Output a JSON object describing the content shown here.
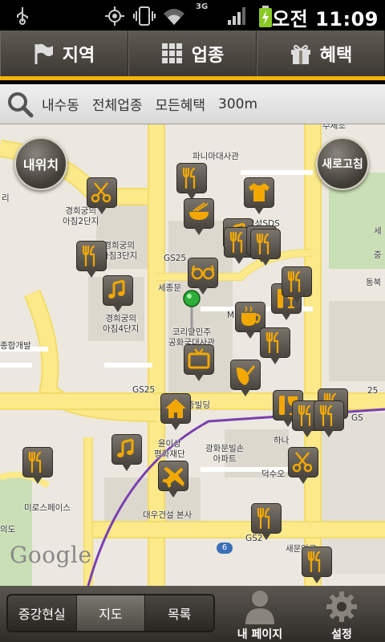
{
  "status_bar": {
    "time": "오전 11:09",
    "icons": [
      "usb-icon",
      "gps-icon",
      "vibrate-icon",
      "wifi-icon",
      "3g-icon",
      "signal-icon",
      "battery-charging-icon"
    ],
    "network_label": "3G"
  },
  "tabs": [
    {
      "label": "지역",
      "icon": "flag-icon"
    },
    {
      "label": "업종",
      "icon": "grid-icon"
    },
    {
      "label": "혜택",
      "icon": "gift-icon"
    }
  ],
  "filter": {
    "chips": [
      "내수동",
      "전체업종",
      "모든혜택",
      "300m"
    ]
  },
  "map": {
    "my_location_label": "내위치",
    "refresh_label": "새로고침",
    "attribution": "Google",
    "route_number": "6",
    "labels": [
      "파니마대사관",
      "경희궁의\n아침2단지",
      "경희궁의\n아침3단지",
      "경희궁의\n아침4단지",
      "GS25",
      "세종문",
      "코리안민주\n공화국대사관",
      "GS25",
      "종빌딩",
      "윤이상\n평화재단",
      "광화문빌손\n아파트",
      "덕수오",
      "미로스페이스",
      "대우건설 본사",
      "새문안교",
      "GS2",
      "삼성SDS",
      "종합개발",
      "하나",
      "수제조",
      "리",
      "의도",
      "중",
      "동북",
      "세",
      "GS",
      "M",
      "25"
    ],
    "pins": [
      "restaurant-icon",
      "noodle-icon",
      "shirt-icon",
      "scissors-icon",
      "music-icon",
      "restaurant-icon",
      "music-icon",
      "restaurant-icon",
      "glasses-icon",
      "music-icon",
      "restaurant-icon",
      "coffee-icon",
      "wine-icon",
      "restaurant-icon",
      "restaurant-icon",
      "tv-icon",
      "gift-icon",
      "home-icon",
      "wine-icon",
      "restaurant-icon",
      "restaurant-icon",
      "scissors-icon",
      "restaurant-icon",
      "music-icon",
      "airplane-icon",
      "restaurant-icon",
      "restaurant-icon",
      "restaurant-icon"
    ]
  },
  "bottom": {
    "segments": [
      "증강현실",
      "지도",
      "목록"
    ],
    "active_segment": "지도",
    "my_page_label": "내 페이지",
    "settings_label": "설정"
  },
  "colors": {
    "accent": "#f4b400",
    "pin_icon": "#f2a800",
    "road": "#fbe98a",
    "route": "#7a3fb0"
  }
}
